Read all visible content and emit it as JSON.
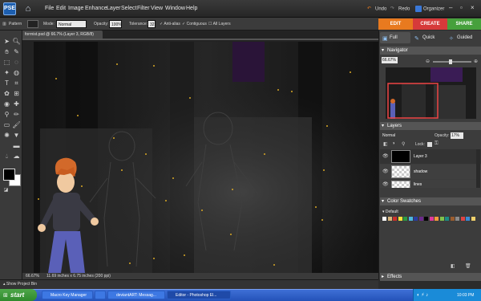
{
  "app": {
    "logo_text": "PSE",
    "menus": [
      "File",
      "Edit",
      "Image",
      "Enhance",
      "Layer",
      "Select",
      "Filter",
      "View",
      "Window",
      "Help"
    ],
    "undo": "Undo",
    "redo": "Redo",
    "organizer": "Organizer"
  },
  "modes": {
    "edit": "EDIT",
    "create": "CREATE",
    "share": "SHARE",
    "edit_color": "#e87a1f",
    "create_color": "#d63a3a",
    "share_color": "#46a03c"
  },
  "options": {
    "pattern": "Pattern",
    "mode_label": "Mode:",
    "mode_value": "Normal",
    "opacity_label": "Opacity:",
    "opacity_value": "100%",
    "tolerance_label": "Tolerance:",
    "tolerance_value": "32",
    "antialias": "Anti-alias",
    "contiguous": "Contiguous",
    "alllayers": "All Layers"
  },
  "panel_tabs": {
    "full": "Full",
    "quick": "Quick",
    "guided": "Guided"
  },
  "document": {
    "tab_title": "forrnist.psd @ 66.7% (Layer 3, RGB/8)",
    "zoom": "66.67%",
    "size": "11.69 inches x 6.75 inches (200 ppi)"
  },
  "navigator": {
    "title": "Navigator",
    "zoom": "66.67%"
  },
  "layers": {
    "title": "Layers",
    "blend": "Normal",
    "opacity_label": "Opacity:",
    "opacity_value": "17%",
    "lock_label": "Lock:",
    "items": [
      {
        "name": "Layer 3"
      },
      {
        "name": "shadow"
      },
      {
        "name": "lines"
      }
    ]
  },
  "swatches": {
    "title": "Color Swatches",
    "set": "Default",
    "colors": [
      "#ffffff",
      "#d7b57a",
      "#c9302b",
      "#f6e23b",
      "#2b9b42",
      "#4bb7e0",
      "#2a3ca0",
      "#6d2a8b",
      "#000000",
      "#e03a9b",
      "#f59a3c",
      "#7fc24b",
      "#1c8a84",
      "#9a5c2e",
      "#8a8a8a",
      "#d44",
      "#3a8bd4",
      "#efd06b"
    ]
  },
  "effects": {
    "title": "Effects"
  },
  "project_bin": "Show Project Bin",
  "taskbar": {
    "start": "start",
    "tasks": [
      {
        "label": "Macro Key Manager"
      },
      {
        "label": ""
      },
      {
        "label": "deviantART: Messag..."
      },
      {
        "label": "Editor - Photoshop El..."
      }
    ],
    "clock": "10:03 PM"
  }
}
